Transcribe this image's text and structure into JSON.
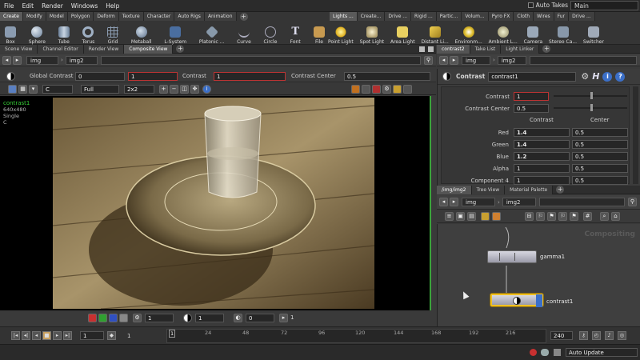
{
  "menubar": {
    "items": [
      "File",
      "Edit",
      "Render",
      "Windows",
      "Help"
    ],
    "auto_takes": "Auto Takes",
    "desktop": "Main"
  },
  "shelf": {
    "left_tabs": [
      "Create",
      "Modify",
      "Model",
      "Polygon",
      "Deform",
      "Texture",
      "Character",
      "Auto Rigs",
      "Animation"
    ],
    "right_tabs": [
      "Lights ...",
      "Create...",
      "Drive ...",
      "Rigid ...",
      "Partic...",
      "Volum...",
      "Pyro FX",
      "Cloth",
      "Wires",
      "Fur",
      "Drive ..."
    ],
    "left_tools": [
      "Box",
      "Sphere",
      "Tube",
      "Torus",
      "Grid",
      "Metaball",
      "L-System",
      "Platonic ...",
      "Curve",
      "Circle",
      "Font",
      "File"
    ],
    "right_tools": [
      "Point Light",
      "Spot Light",
      "Area Light",
      "Distant Li...",
      "Environm...",
      "Ambient L...",
      "Camera",
      "Stereo Ca...",
      "Switcher"
    ]
  },
  "left_tabs": [
    "Scene View",
    "Channel Editor",
    "Render View",
    "Composite View"
  ],
  "left_path": [
    "img",
    "img2"
  ],
  "viewer_params": {
    "global_contrast_label": "Global Contrast",
    "global_contrast_value": "0",
    "global_contrast_value2": "1",
    "contrast_label": "Contrast",
    "contrast_value": "1",
    "contrast_center_label": "Contrast Center",
    "contrast_center_value": "0.5"
  },
  "viewer_toolbar": {
    "plane": "C",
    "resolution": "Full",
    "split": "2x2"
  },
  "viewer_info": {
    "node": "contrast1",
    "res": "640x480",
    "mode": "Single",
    "plane": "C"
  },
  "viewer_bottom": {
    "val1": "1",
    "val2": "1",
    "val3": "0",
    "val4": "1"
  },
  "timeline": {
    "start": "1",
    "current": "1",
    "ticks": [
      "1",
      "24",
      "48",
      "72",
      "96",
      "120",
      "144",
      "168",
      "192",
      "216"
    ],
    "end": "240"
  },
  "right_top_tabs": [
    "contrast2",
    "Take List",
    "Light Linker"
  ],
  "right_top_path": [
    "img",
    "img2"
  ],
  "params": {
    "type": "Contrast",
    "name": "contrast1",
    "contrast_label": "Contrast",
    "contrast_value": "1",
    "center_label": "Contrast Center",
    "center_value": "0.5",
    "table_headers": [
      "Contrast",
      "Center"
    ],
    "rows": [
      {
        "label": "Red",
        "contrast": "1.4",
        "center": "0.5"
      },
      {
        "label": "Green",
        "contrast": "1.4",
        "center": "0.5"
      },
      {
        "label": "Blue",
        "contrast": "1.2",
        "center": "0.5"
      },
      {
        "label": "Alpha",
        "contrast": "1",
        "center": "0.5"
      },
      {
        "label": "Component 4",
        "contrast": "1",
        "center": "0.5"
      }
    ]
  },
  "right_bottom_tabs": [
    "/img/img2",
    "Tree View",
    "Material Palette"
  ],
  "right_bottom_path": [
    "img",
    "img2"
  ],
  "network": {
    "context": "Compositing",
    "nodes": [
      "gamma1",
      "contrast1"
    ]
  },
  "status": {
    "auto_update": "Auto Update"
  },
  "colors": {
    "viewer_highlight": "#3aa33a",
    "selected_node": "#f0c020"
  }
}
